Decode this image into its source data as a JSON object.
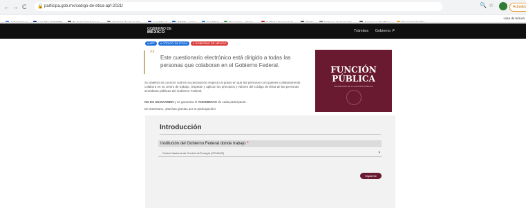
{
  "browser": {
    "back": "←",
    "forward": "→",
    "reload": "C",
    "url": "participa.gob.mx/codigo-de-etica-apf-2021/",
    "update_label": "Actualizar"
  },
  "bookmarks": {
    "items": [
      {
        "label": "Aplicaciones",
        "color": "#4285f4"
      },
      {
        "label": "servCloud CORP",
        "color": "#1a3e8c"
      },
      {
        "label": "Te damos la bienve...",
        "color": "#555555"
      },
      {
        "label": "Sistema de Seguimi...",
        "color": "#888888"
      },
      {
        "label": "servCloud",
        "color": "#1a3e8c"
      },
      {
        "label": "CBPO - Inicio",
        "color": "#1565c0"
      },
      {
        "label": "Igualdad",
        "color": "#1e88e5"
      },
      {
        "label": "Recursos – Cisco...",
        "color": "#43a047"
      },
      {
        "label": "Instituto Nacional d...",
        "color": "#c62828"
      },
      {
        "label": "PAVH",
        "color": "#555555"
      },
      {
        "label": "Sistema de Seguimi...",
        "color": "#888888"
      },
      {
        "label": "Sesiones del Pleno",
        "color": "#555555"
      },
      {
        "label": "Denuncia Digital",
        "color": "#f9a825"
      }
    ],
    "right_label": "Lista de lectura"
  },
  "site": {
    "logo_line1": "GOBIERNO DE",
    "logo_line2": "MÉXICO",
    "nav": [
      "Trámites",
      "Gobierno"
    ]
  },
  "tags": [
    {
      "label": "# APF",
      "color": "#1e6fd9"
    },
    {
      "label": "# CÓDIGO DE ÉTICA",
      "color": "#1e6fd9"
    },
    {
      "label": "# GOBIERNO DE MÉXICO",
      "color": "#d93b3b"
    }
  ],
  "quote": "Este cuestionario electrónico está dirigido a todas las personas que colaboran en el Gobierno Federal.",
  "banner": {
    "line1": "FUNCIÓN",
    "line2": "PÚBLICA",
    "line3": "SECRETARÍA DE LA FUNCIÓN PÚBLICA"
  },
  "intro": "Su objetivo es conocer cuál es su percepción respecto al grado en que las personas con quienes cotidianamente colabora en su centro de trabajo, respetan y aplican los principios y valores del Código de Ética de las personas servidoras públicas del Gobierno Federal.",
  "warning": {
    "strong1": "NO ES UN EXAMEN",
    "mid": " y se garantiza el ",
    "strong2": "ANONIMATO",
    "end": " de cada participante."
  },
  "thanks": "De antemano, ¡Muchas gracias por tu participación!",
  "form": {
    "title": "Introducción",
    "question": "Institución del Gobierno Federal donde trabajo",
    "required_mark": "*",
    "selected": "Centro Nacional de Control de Energía (CENACE)",
    "next_label": "Siguiente"
  },
  "colors": {
    "brand": "#6a1a30",
    "topbar": "#101010",
    "card": "#f2f2f2"
  }
}
